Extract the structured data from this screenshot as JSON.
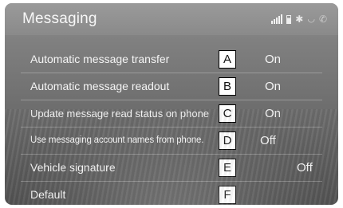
{
  "header": {
    "title": "Messaging"
  },
  "settings": [
    {
      "label": "Automatic message transfer",
      "callout": "A",
      "value": "On"
    },
    {
      "label": "Automatic message readout",
      "callout": "B",
      "value": "On"
    },
    {
      "label": "Update message read status on phone",
      "callout": "C",
      "value": "On"
    },
    {
      "label": "Use messaging account names from phone.",
      "callout": "D",
      "value": "Off"
    },
    {
      "label": "Vehicle signature",
      "callout": "E",
      "value": "Off"
    },
    {
      "label": "Default",
      "callout": "F"
    }
  ],
  "status_icons": [
    "signal-icon",
    "battery-icon",
    "bluetooth-icon",
    "wifi-icon",
    "phone-icon"
  ]
}
